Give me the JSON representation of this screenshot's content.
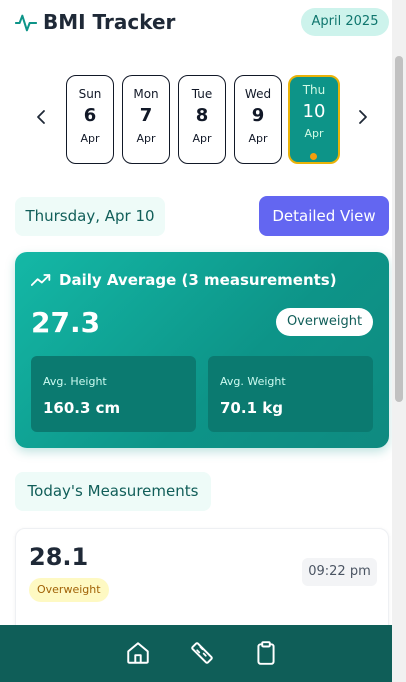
{
  "header": {
    "title": "BMI Tracker",
    "month_badge": "April 2025",
    "logo_icon": "activity-pulse-icon"
  },
  "date_strip": {
    "prev_icon": "chevron-left-icon",
    "next_icon": "chevron-right-icon",
    "days": [
      {
        "dow": "Sun",
        "dom": "6",
        "mon": "Apr",
        "selected": false
      },
      {
        "dow": "Mon",
        "dom": "7",
        "mon": "Apr",
        "selected": false
      },
      {
        "dow": "Tue",
        "dom": "8",
        "mon": "Apr",
        "selected": false
      },
      {
        "dow": "Wed",
        "dom": "9",
        "mon": "Apr",
        "selected": false
      },
      {
        "dow": "Thu",
        "dom": "10",
        "mon": "Apr",
        "selected": true
      }
    ]
  },
  "selected_date_label": "Thursday, Apr 10",
  "detailed_view_label": "Detailed View",
  "daily_average": {
    "icon": "trending-up-icon",
    "title": "Daily Average (3 measurements)",
    "bmi": "27.3",
    "status": "Overweight",
    "height_label": "Avg. Height",
    "height_value": "160.3 cm",
    "weight_label": "Avg. Weight",
    "weight_value": "70.1 kg"
  },
  "measurements": {
    "heading": "Today's Measurements",
    "items": [
      {
        "bmi": "28.1",
        "status": "Overweight",
        "time": "09:22 pm"
      }
    ]
  },
  "bottom_nav": {
    "items": [
      "home-icon",
      "ruler-icon",
      "clipboard-icon"
    ]
  },
  "colors": {
    "accent": "#0d9488",
    "primary_button": "#6366f1",
    "nav_background": "#0f5e58",
    "warning": "#f59e0b"
  }
}
